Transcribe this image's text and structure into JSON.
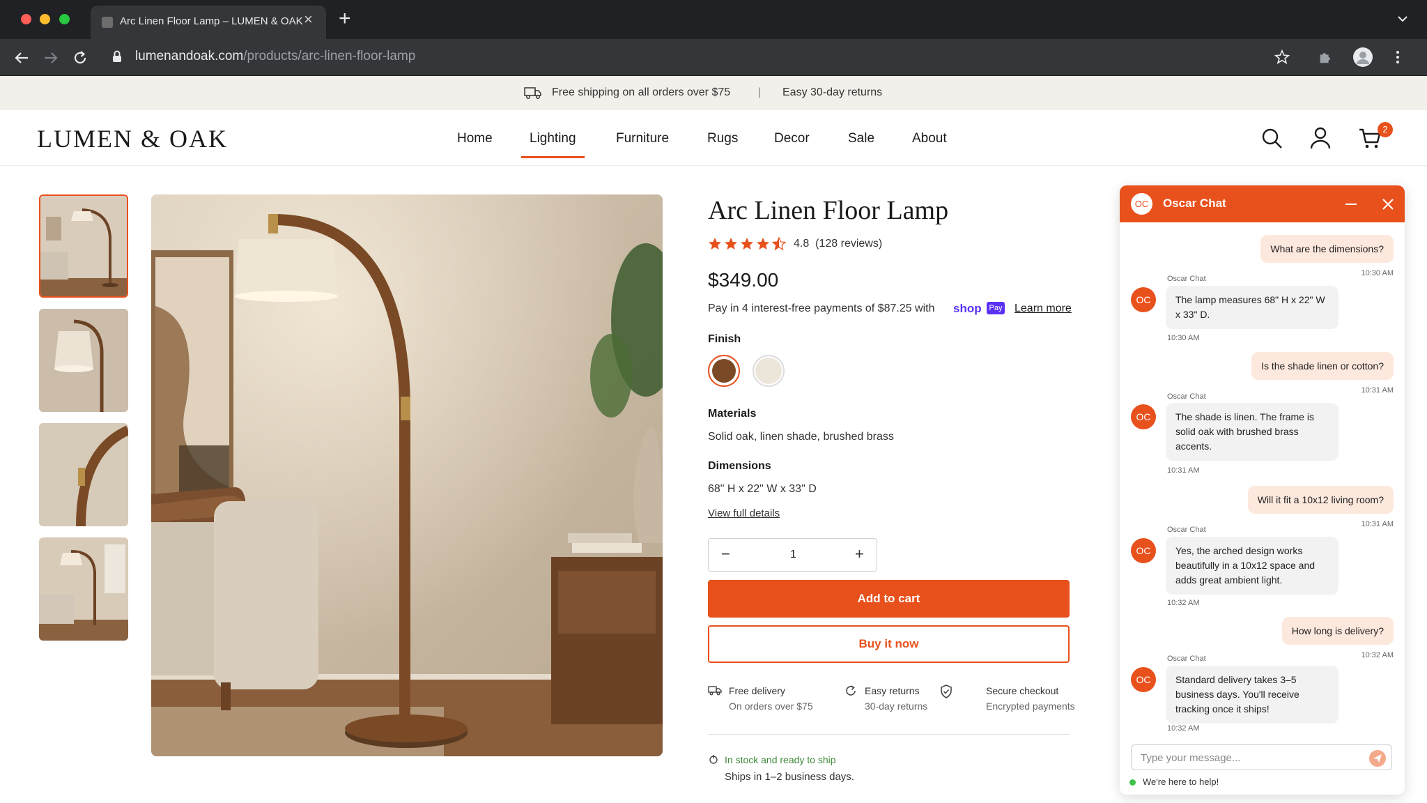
{
  "browser": {
    "tab_title": "Arc Linen Floor Lamp – LUMEN & OAK",
    "url_domain": "lumenandoak.com",
    "url_path": "/products/arc-linen-floor-lamp",
    "new_tab_label": "+",
    "close_tab_label": "×"
  },
  "announcement": {
    "shipping": "Free shipping on all orders over $75",
    "separator": "|",
    "returns": "Easy 30-day returns"
  },
  "header": {
    "logo": "LUMEN & OAK",
    "nav": [
      {
        "label": "Home"
      },
      {
        "label": "Lighting",
        "active": true
      },
      {
        "label": "Furniture"
      },
      {
        "label": "Rugs"
      },
      {
        "label": "Decor"
      },
      {
        "label": "Sale"
      },
      {
        "label": "About"
      }
    ],
    "cart_count": "2"
  },
  "product": {
    "title": "Arc Linen Floor Lamp",
    "rating_value": "4.8",
    "rating_stars": 4.5,
    "reviews": "(128 reviews)",
    "price": "$349.00",
    "installments": "Pay in 4 interest-free payments of $87.25 with",
    "shop_logo": "shop",
    "shop_pay": "Pay",
    "learn_more": "Learn more",
    "finish_label": "Finish",
    "finish_options": [
      {
        "name": "Walnut",
        "color": "#7a4a26",
        "selected": true
      },
      {
        "name": "Cream",
        "color": "#ece5da",
        "selected": false
      }
    ],
    "materials_label": "Materials",
    "materials": "Solid oak, linen shade, brushed brass",
    "dimensions_label": "Dimensions",
    "dimensions": "68\" H x 22\" W x 33\" D",
    "view_details": "View full details",
    "qty_minus": "−",
    "qty_plus": "+",
    "quantity": "1",
    "add_to_cart": "Add to cart",
    "buy_now": "Buy it now",
    "features": [
      {
        "icon": "truck-icon",
        "title": "Free delivery",
        "sub": "On orders over $75"
      },
      {
        "icon": "refresh-icon",
        "title": "Easy returns",
        "sub": "30-day returns"
      },
      {
        "icon": "shield-check-icon",
        "title": "Secure checkout",
        "sub": "Encrypted payments"
      }
    ],
    "stock": "In stock and ready to ship",
    "shipping_time": "Ships in 1–2 business days."
  },
  "chat": {
    "avatar": "OC",
    "title": "Oscar Chat",
    "messages": [
      {
        "from": "user",
        "text": "What are the dimensions?",
        "time": "10:30 AM"
      },
      {
        "from": "bot",
        "sender": "Oscar Chat",
        "lines": [
          "The lamp measures 68\" H x 22\" W",
          "x 33\" D."
        ],
        "time": "10:30 AM"
      },
      {
        "from": "user",
        "text": "Is the shade linen or cotton?",
        "time": "10:31 AM"
      },
      {
        "from": "bot",
        "sender": "Oscar Chat",
        "lines": [
          "The shade is linen. The frame is",
          "solid oak with brushed brass",
          "accents."
        ],
        "time": "10:31 AM"
      },
      {
        "from": "user",
        "text": "Will it fit a 10x12 living room?",
        "time": "10:31 AM"
      },
      {
        "from": "bot",
        "sender": "Oscar Chat",
        "lines": [
          "Yes, the arched design works",
          "beautifully in a 10x12 space and",
          "adds great ambient light."
        ],
        "time": "10:32 AM"
      },
      {
        "from": "user",
        "text": "How long is delivery?",
        "time": "10:32 AM"
      },
      {
        "from": "bot",
        "sender": "Oscar Chat",
        "lines": [
          "Standard delivery takes 3–5",
          "business days. You'll receive",
          "tracking once it ships!"
        ],
        "time": "10:32 AM"
      }
    ],
    "input_placeholder": "Type your message...",
    "status": "We're here to help!"
  },
  "colors": {
    "accent": "#e8501c",
    "announcement_bg": "#f3f0eb",
    "user_bubble": "#fde8dd",
    "bot_bubble": "#f2f2f2",
    "online": "#3ec24a"
  }
}
